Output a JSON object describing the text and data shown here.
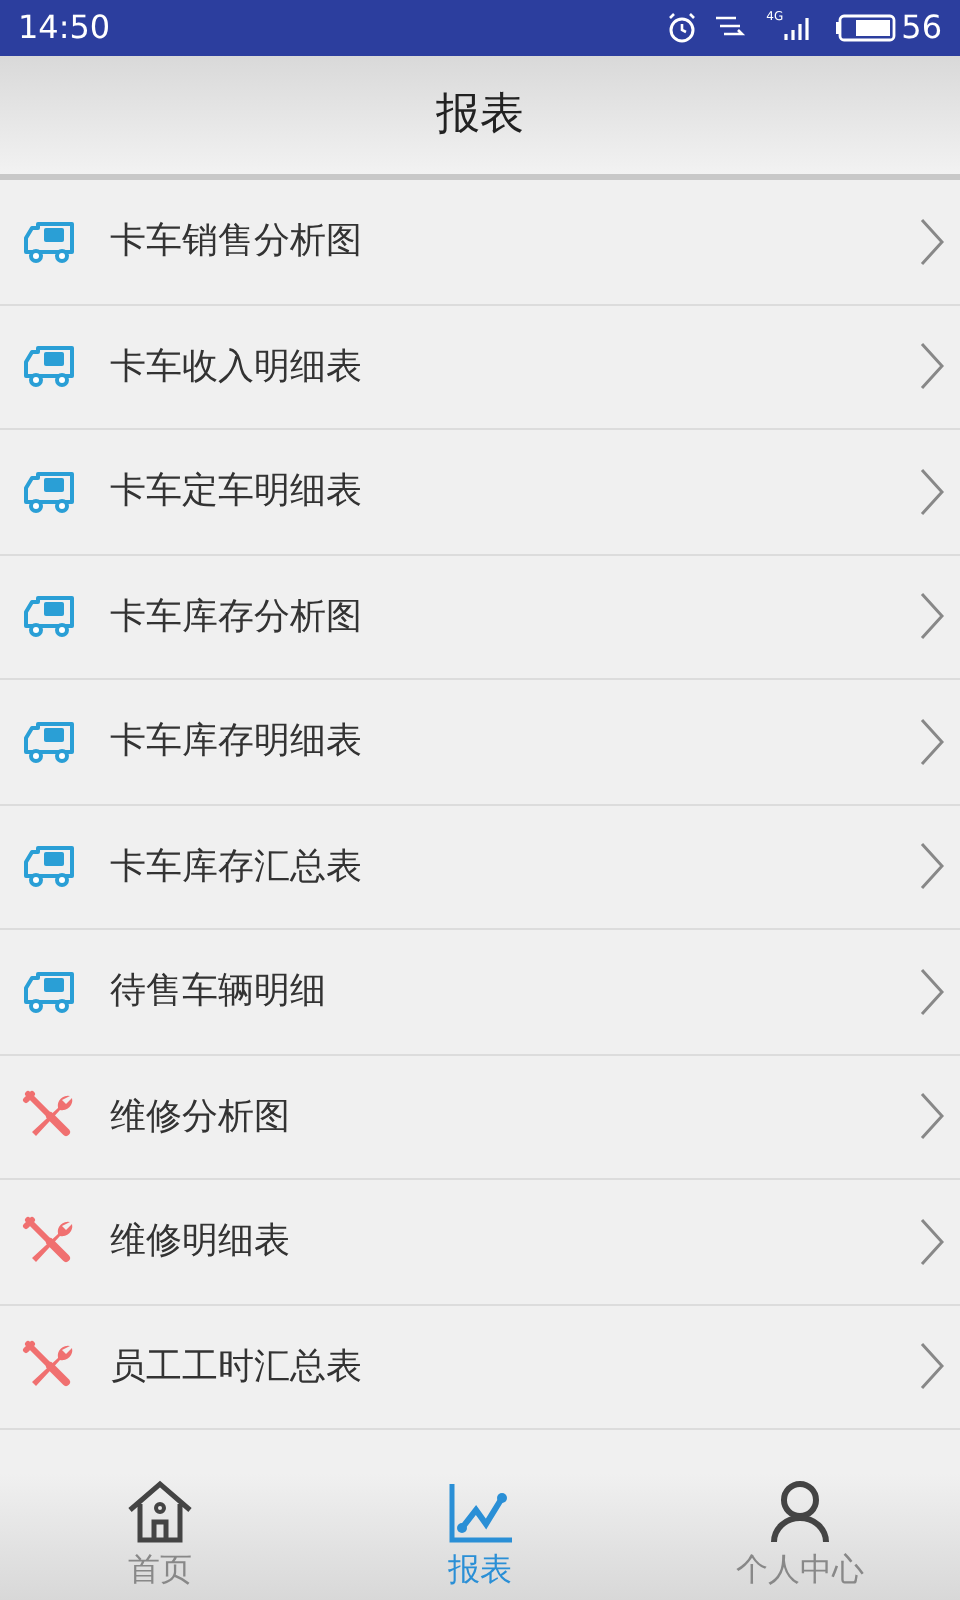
{
  "status_bar": {
    "time": "14:50",
    "network": "4G",
    "battery": "56"
  },
  "header": {
    "title": "报表"
  },
  "reports": [
    {
      "label": "卡车销售分析图",
      "kind": "truck"
    },
    {
      "label": "卡车收入明细表",
      "kind": "truck"
    },
    {
      "label": "卡车定车明细表",
      "kind": "truck"
    },
    {
      "label": "卡车库存分析图",
      "kind": "truck"
    },
    {
      "label": "卡车库存明细表",
      "kind": "truck"
    },
    {
      "label": "卡车库存汇总表",
      "kind": "truck"
    },
    {
      "label": "待售车辆明细",
      "kind": "truck"
    },
    {
      "label": "维修分析图",
      "kind": "repair"
    },
    {
      "label": "维修明细表",
      "kind": "repair"
    },
    {
      "label": "员工工时汇总表",
      "kind": "repair"
    }
  ],
  "bottom_nav": [
    {
      "label": "首页",
      "kind": "home",
      "selected": false
    },
    {
      "label": "报表",
      "kind": "chart",
      "selected": true
    },
    {
      "label": "个人中心",
      "kind": "person",
      "selected": false
    }
  ]
}
